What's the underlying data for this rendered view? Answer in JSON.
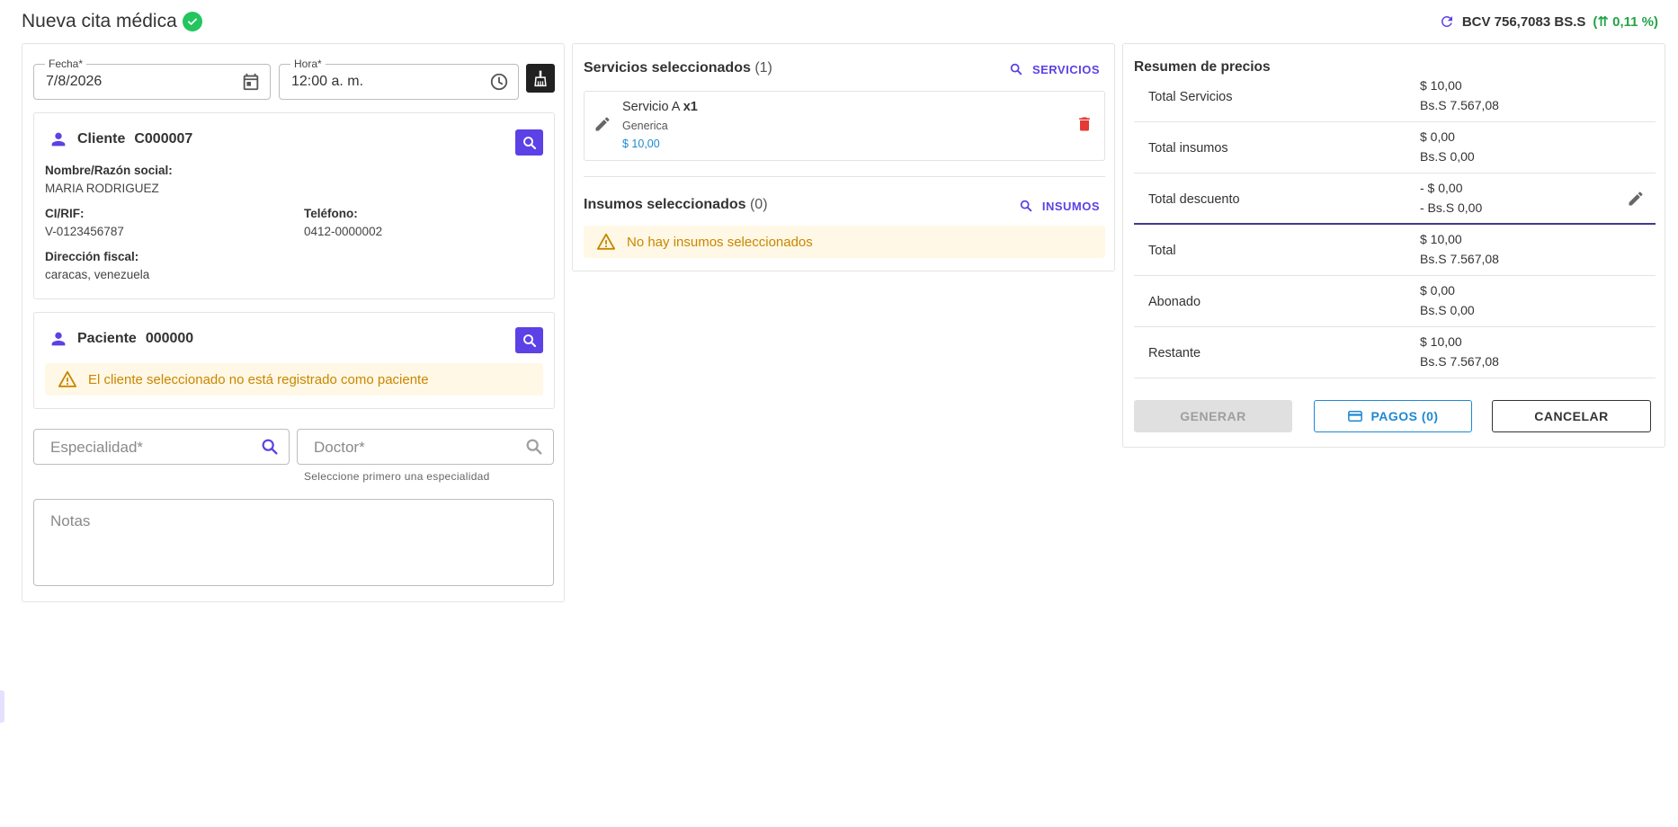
{
  "header": {
    "title": "Nueva cita médica",
    "rate_label": "BCV 756,7083 BS.S",
    "rate_change": "(⇈ 0,11 %)"
  },
  "appointment": {
    "date_label": "Fecha*",
    "date_value": "7/8/2026",
    "time_label": "Hora*",
    "time_value": "12:00 a. m."
  },
  "client": {
    "heading": "Cliente",
    "code": "C000007",
    "name_label": "Nombre/Razón social:",
    "name_value": "MARIA RODRIGUEZ",
    "rif_label": "CI/RIF:",
    "rif_value": "V-0123456787",
    "phone_label": "Teléfono:",
    "phone_value": "0412-0000002",
    "address_label": "Dirección fiscal:",
    "address_value": "caracas, venezuela"
  },
  "patient": {
    "heading": "Paciente",
    "code": "000000",
    "warning": "El cliente seleccionado no está registrado como paciente"
  },
  "specialty": {
    "placeholder": "Especialidad*"
  },
  "doctor": {
    "placeholder": "Doctor*",
    "helper": "Seleccione primero una especialidad"
  },
  "notes": {
    "placeholder": "Notas"
  },
  "services": {
    "title": "Servicios seleccionados",
    "count": "(1)",
    "action": "SERVICIOS",
    "items": [
      {
        "name": "Servicio A",
        "qty": "x1",
        "category": "Generica",
        "price": "$ 10,00"
      }
    ]
  },
  "supplies": {
    "title": "Insumos seleccionados",
    "count": "(0)",
    "action": "INSUMOS",
    "empty": "No hay insumos seleccionados"
  },
  "summary": {
    "title": "Resumen de precios",
    "rows": [
      {
        "label": "Total Servicios",
        "usd": "$ 10,00",
        "bs": "Bs.S 7.567,08"
      },
      {
        "label": "Total insumos",
        "usd": "$ 0,00",
        "bs": "Bs.S 0,00"
      },
      {
        "label": "Total descuento",
        "usd": "- $ 0,00",
        "bs": "- Bs.S 0,00"
      },
      {
        "label": "Total",
        "usd": "$ 10,00",
        "bs": "Bs.S 7.567,08"
      },
      {
        "label": "Abonado",
        "usd": "$ 0,00",
        "bs": "Bs.S 0,00"
      },
      {
        "label": "Restante",
        "usd": "$ 10,00",
        "bs": "Bs.S 7.567,08"
      }
    ],
    "generate_label": "GENERAR",
    "payments_label": "PAGOS (0)",
    "cancel_label": "CANCELAR"
  },
  "colors": {
    "accent": "#5b41e6",
    "success": "#22c55e",
    "warning": "#c98600",
    "danger": "#e53935",
    "link_blue": "#1e88d2"
  }
}
